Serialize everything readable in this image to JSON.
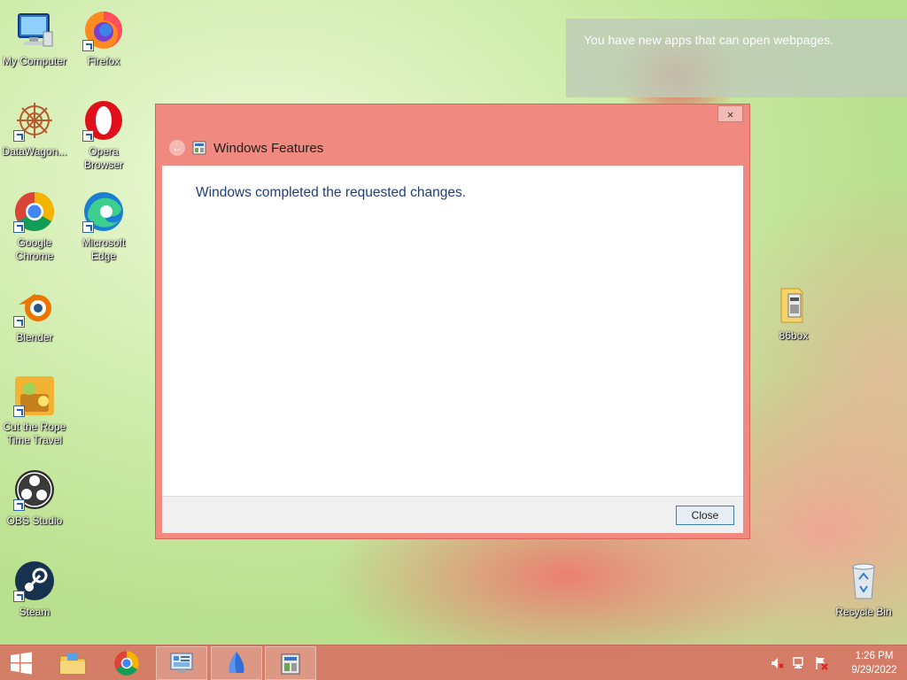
{
  "desktop_icons": [
    {
      "label": "My Computer"
    },
    {
      "label": "Firefox"
    },
    {
      "label": "DataWagon..."
    },
    {
      "label": "Opera Browser"
    },
    {
      "label": "Google Chrome"
    },
    {
      "label": "Microsoft Edge"
    },
    {
      "label": "Blender"
    },
    {
      "label": "Cut the Rope Time Travel"
    },
    {
      "label": "OBS Studio"
    },
    {
      "label": "Steam"
    },
    {
      "label": "86box"
    },
    {
      "label": "Recycle Bin"
    }
  ],
  "notification": {
    "text": "You have new apps that can open webpages."
  },
  "dialog": {
    "title": "Windows Features",
    "message": "Windows completed the requested changes.",
    "close_button_label": "Close",
    "titlebar_close_glyph": "×"
  },
  "taskbar": {
    "items": [
      {
        "icon": "windows-start-icon"
      },
      {
        "icon": "file-explorer-icon"
      },
      {
        "icon": "chrome-icon"
      },
      {
        "icon": "control-panel-icon"
      },
      {
        "icon": "app-icon"
      },
      {
        "icon": "windows-features-icon"
      }
    ]
  },
  "tray": {
    "icons": [
      "volume-muted-icon",
      "network-icon",
      "action-center-flag-icon"
    ],
    "time": "1:26 PM",
    "date": "9/29/2022"
  },
  "colors": {
    "dialog_frame": "#f08a80",
    "taskbar": "#d67464",
    "message_text": "#1d3f7a"
  }
}
